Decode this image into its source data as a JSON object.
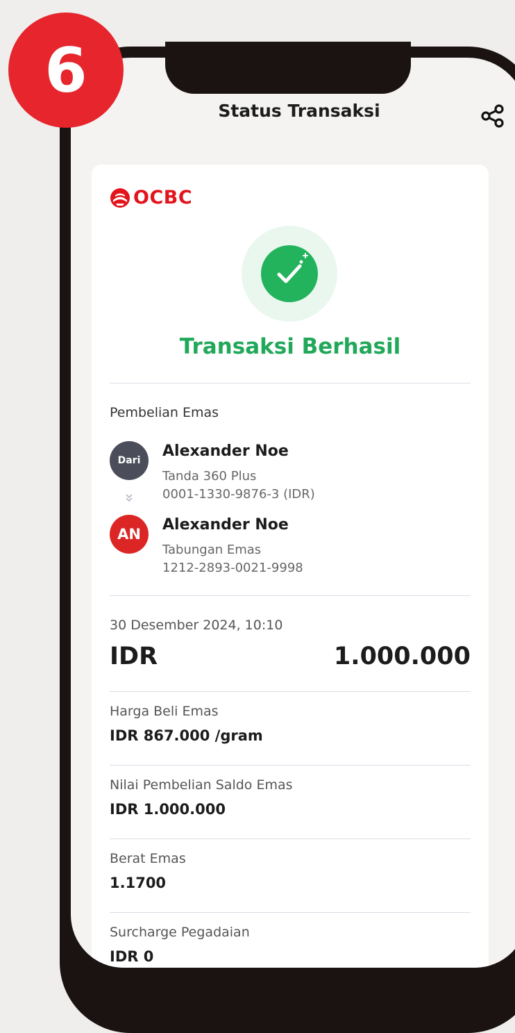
{
  "step": {
    "number": "6",
    "color": "#e6252c"
  },
  "header": {
    "title": "Status Transaksi",
    "share_icon": "share-icon"
  },
  "brand": {
    "name": "OCBC",
    "color": "#e3141b"
  },
  "status": {
    "title": "Transaksi Berhasil",
    "color": "#22a85a",
    "icon": "check-circle-icon"
  },
  "transaction": {
    "type": "Pembelian Emas",
    "from": {
      "avatar_label": "Dari",
      "name": "Alexander Noe",
      "account_type": "Tanda 360 Plus",
      "account_number": "0001-1330-9876-3 (IDR)"
    },
    "to": {
      "avatar_label": "AN",
      "name": "Alexander Noe",
      "account_type": "Tabungan Emas",
      "account_number": "1212-2893-0021-9998"
    },
    "datetime": "30 Desember 2024, 10:10",
    "amount": {
      "currency": "IDR",
      "value": "1.000.000"
    },
    "details": [
      {
        "label": "Harga Beli Emas",
        "value": "IDR 867.000 /gram"
      },
      {
        "label": "Nilai Pembelian Saldo Emas",
        "value": "IDR 1.000.000"
      },
      {
        "label": "Berat Emas",
        "value": "1.1700"
      },
      {
        "label": "Surcharge Pegadaian",
        "value": "IDR 0"
      }
    ]
  }
}
